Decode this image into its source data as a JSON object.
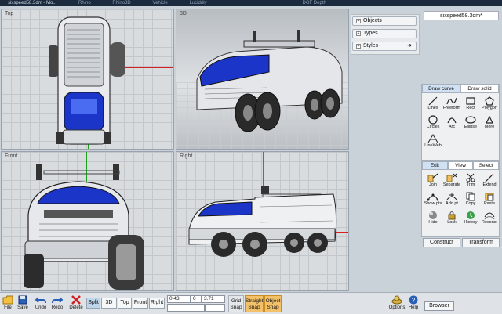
{
  "titlebar": {
    "title": "sixspeed58.3dm - Mo...",
    "menu": [
      "Rhino",
      "Rhino3D",
      "Vehicle",
      "Lucidrity",
      "DOF Depth"
    ]
  },
  "viewports": {
    "top": "Top",
    "perspective": "3D",
    "front": "Front",
    "right": "Right"
  },
  "document_title": "sixspeed58.3dm*",
  "accordion": [
    {
      "label": "Objects"
    },
    {
      "label": "Types"
    },
    {
      "label": "Styles",
      "arrow": "➜"
    }
  ],
  "draw_panel": {
    "tabs": [
      "Draw curve",
      "Draw solid"
    ],
    "tools": [
      "Lines",
      "Freeform",
      "Rect",
      "Polygon",
      "Circles",
      "Arc",
      "Ellipse",
      "More",
      "LineWeb"
    ]
  },
  "edit_panel": {
    "tabs": [
      "Edit",
      "View",
      "Select"
    ],
    "tools": [
      "Join",
      "Separate",
      "Trim",
      "Extend",
      "Show pts",
      "Add pt",
      "Copy",
      "Paste",
      "Hide",
      "Lock",
      "History",
      "Reconst"
    ]
  },
  "bottom_tabs": [
    "Construct",
    "Transform"
  ],
  "toolbar": {
    "file": "File",
    "save": "Save",
    "undo": "Undo",
    "redo": "Redo",
    "delete": "Delete",
    "views": [
      "Split",
      "3D",
      "Top",
      "Front",
      "Right"
    ],
    "coords": [
      "0.43",
      "0",
      "3.71"
    ],
    "grid_snap": [
      "Grid",
      "Snap"
    ],
    "straight_snap": [
      "Straight",
      "Snap"
    ],
    "object_snap": [
      "Object",
      "Snap"
    ],
    "options": "Options",
    "help": "Help",
    "browser": "Browser"
  },
  "colors": {
    "accent_blue": "#1a35c8",
    "snap_on": "#f3c169",
    "axis_x": "#d42020",
    "axis_y": "#1aa31a"
  }
}
